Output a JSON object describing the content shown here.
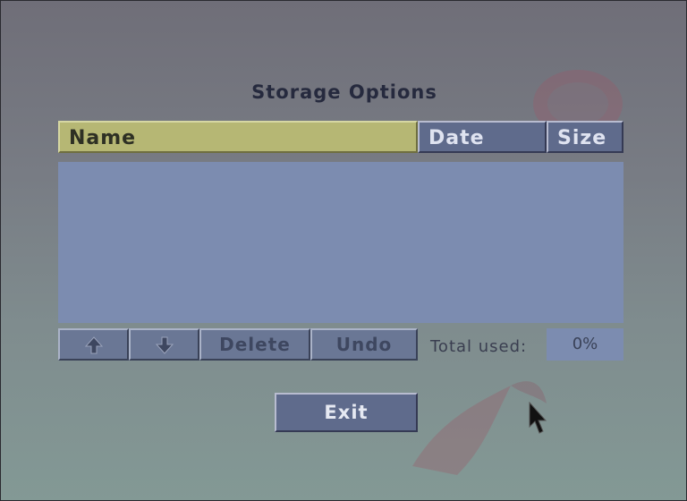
{
  "dialog": {
    "title": "Storage Options",
    "columns": {
      "name": "Name",
      "date": "Date",
      "size": "Size"
    },
    "files": [],
    "buttons": {
      "up_icon": "arrow-up-icon",
      "down_icon": "arrow-down-icon",
      "delete": "Delete",
      "undo": "Undo",
      "exit": "Exit"
    },
    "total_used_label": "Total used:",
    "total_used_value": "0%"
  },
  "colors": {
    "header_selected": "#b6b774",
    "header": "#5f6b8c",
    "list_background": "#7c8cb0",
    "title_text": "#262a3e"
  }
}
